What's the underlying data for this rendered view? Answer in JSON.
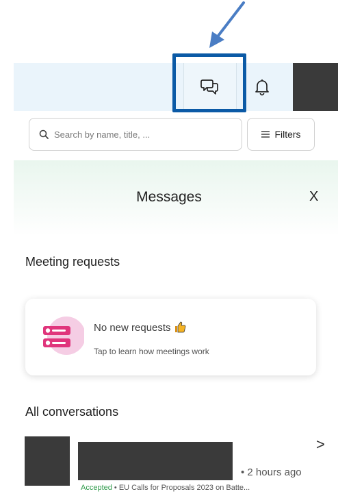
{
  "header": {
    "chat_icon": "chat-bubbles-icon",
    "bell_icon": "bell-icon"
  },
  "search": {
    "placeholder": "Search by name, title, ...",
    "icon": "search-icon"
  },
  "filters": {
    "label": "Filters",
    "icon": "menu-lines-icon"
  },
  "panel": {
    "title": "Messages",
    "close_label": "X"
  },
  "meeting_requests": {
    "heading": "Meeting requests",
    "card_title": "No new requests",
    "card_subtitle": "Tap to learn how meetings work",
    "card_icon": "requests-list-icon",
    "thumb_icon": "thumbs-up-icon"
  },
  "conversations": {
    "heading": "All conversations",
    "items": [
      {
        "time": "• 2 hours ago",
        "status": "Accepted",
        "separator": " • ",
        "preview": "EU Calls for Proposals 2023 on Batte...",
        "chevron": ">"
      }
    ]
  },
  "colors": {
    "highlight_box": "#0b5aa6",
    "arrow": "#4a7dc4",
    "accepted": "#2e9a4a",
    "icon_pink": "#e0357c"
  }
}
